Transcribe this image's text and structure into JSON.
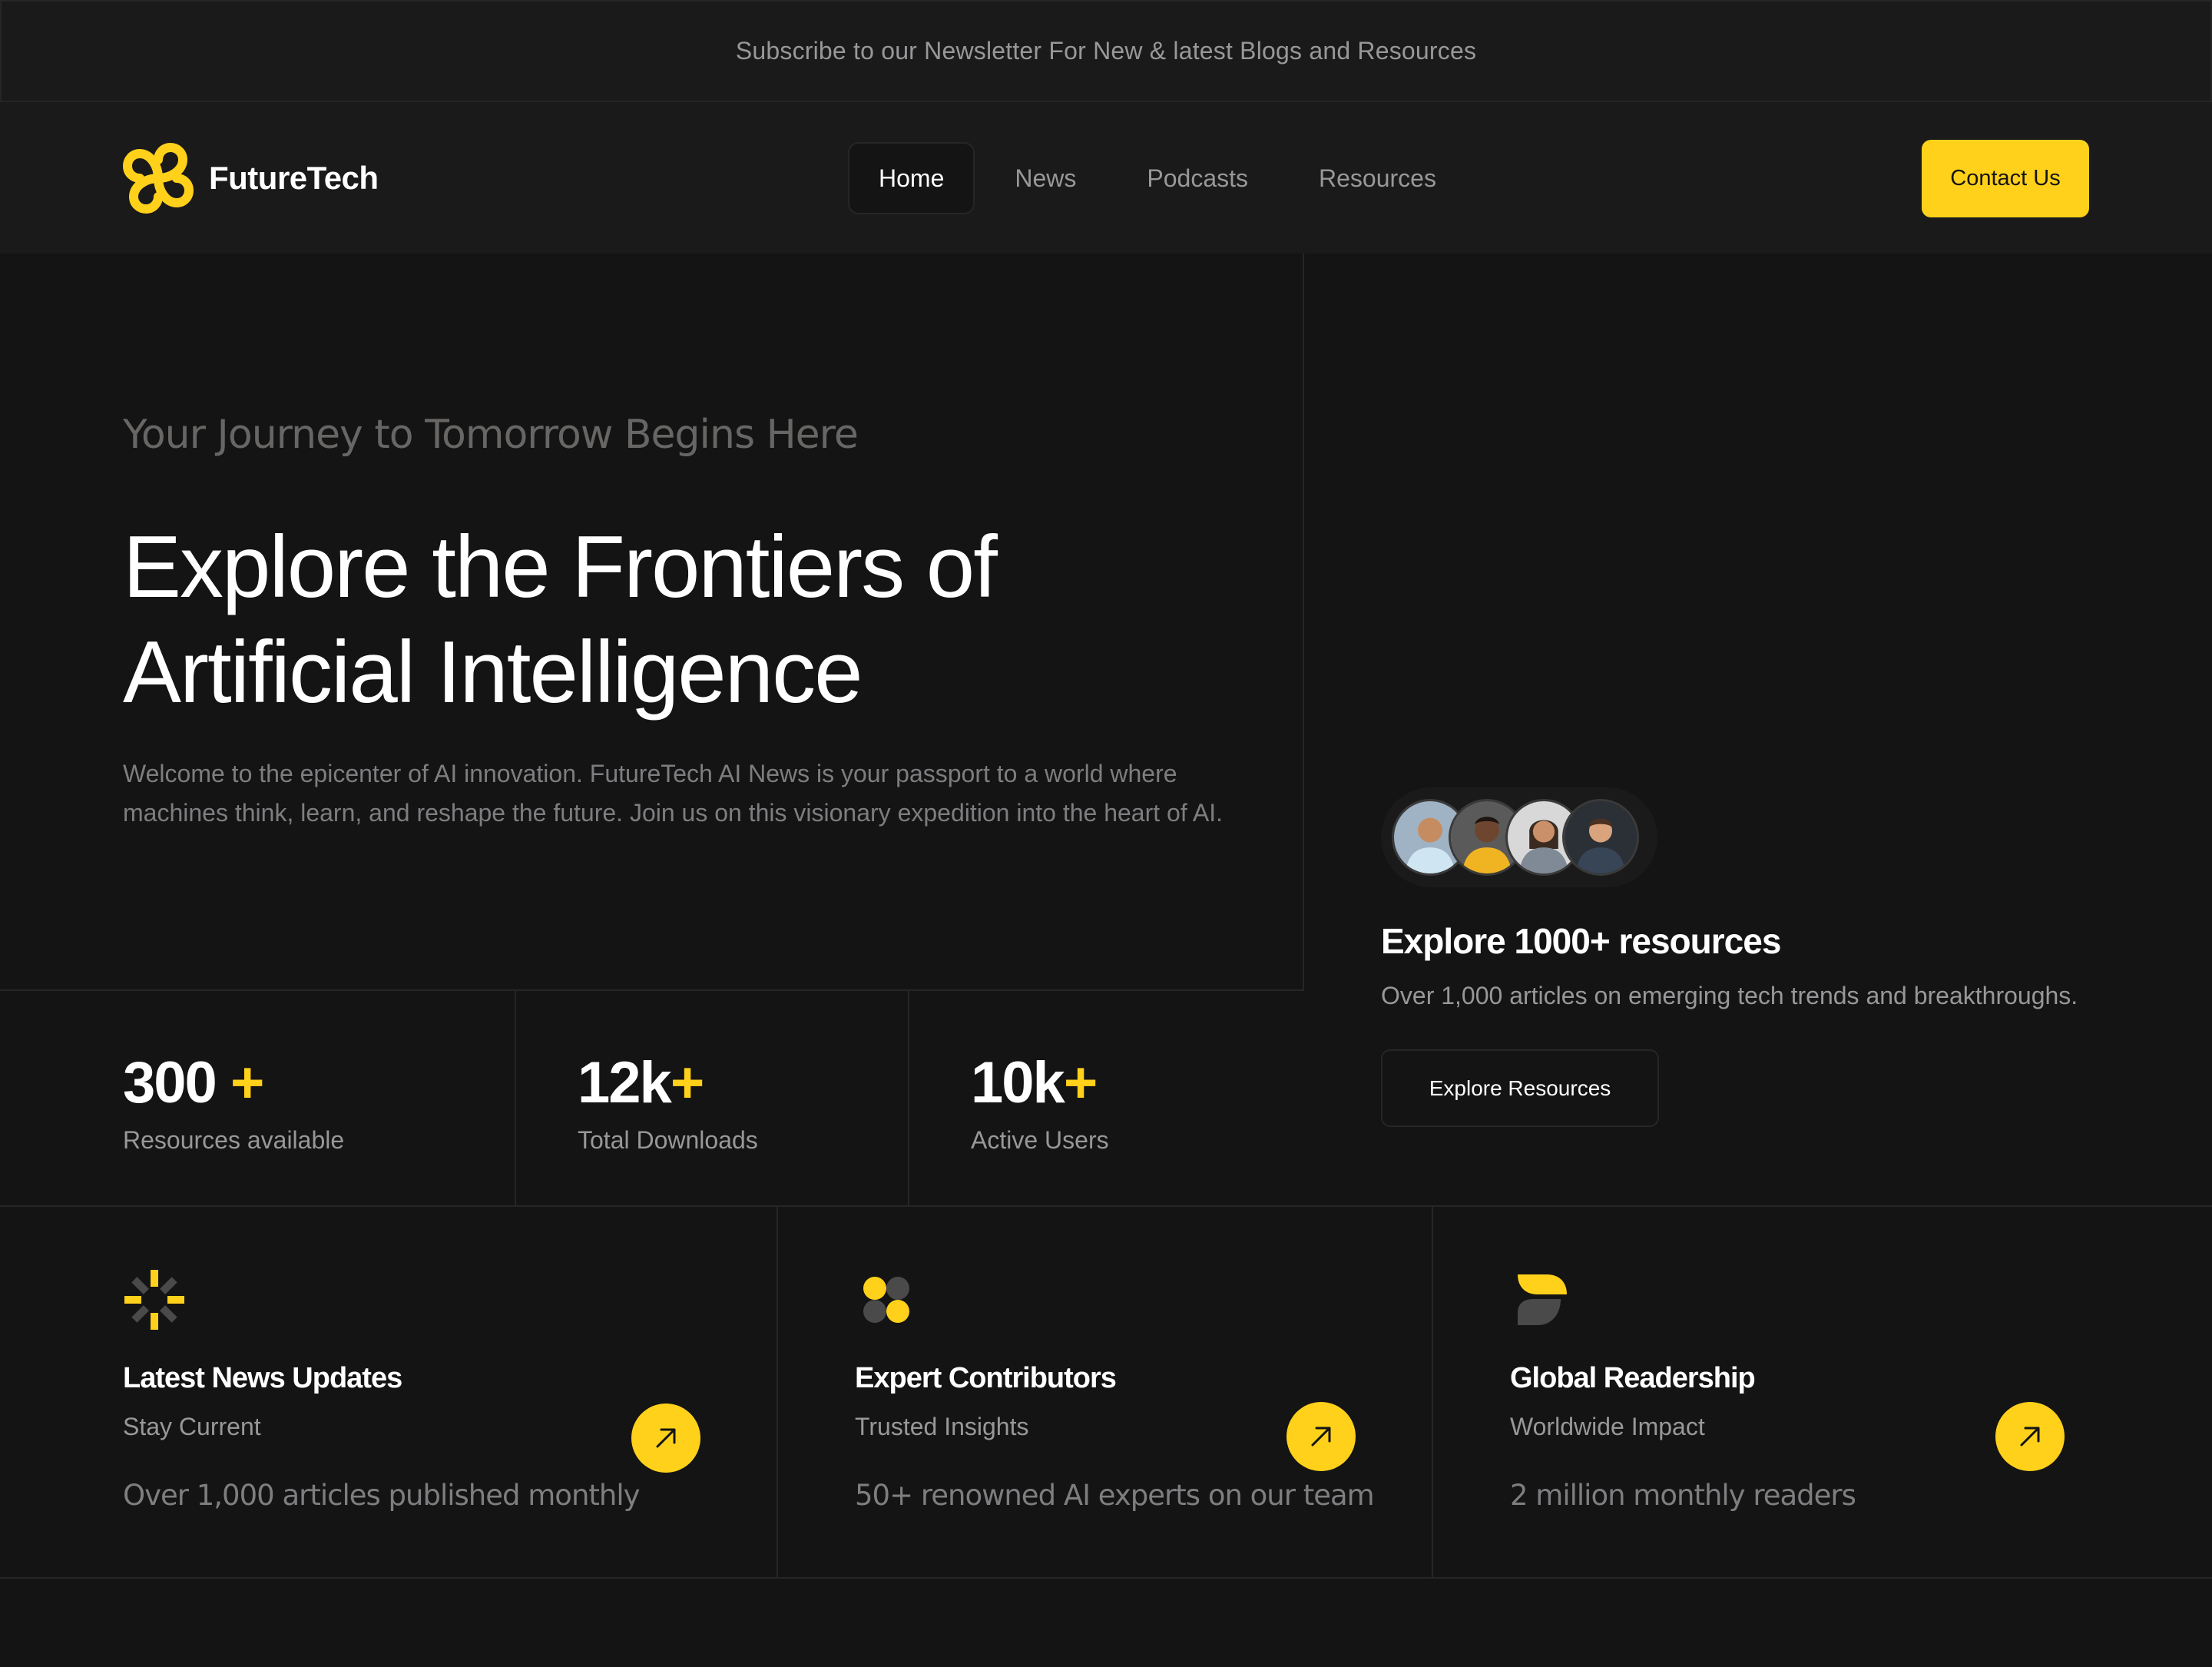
{
  "banner": {
    "text": "Subscribe to our Newsletter For New & latest Blogs and Resources"
  },
  "header": {
    "brand": "FutureTech",
    "nav": [
      {
        "label": "Home",
        "active": true
      },
      {
        "label": "News",
        "active": false
      },
      {
        "label": "Podcasts",
        "active": false
      },
      {
        "label": "Resources",
        "active": false
      }
    ],
    "contact_label": "Contact Us"
  },
  "hero": {
    "subtitle": "Your Journey to Tomorrow Begins Here",
    "title_line1": "Explore the Frontiers of",
    "title_line2": "Artificial Intelligence",
    "description": "Welcome to the epicenter of AI innovation. FutureTech AI News is your passport to a world where machines think, learn, and reshape the future. Join us on this visionary expedition into the heart of AI."
  },
  "stats": [
    {
      "value": "300",
      "plus": "+",
      "label": "Resources available"
    },
    {
      "value": "12k",
      "plus": "+",
      "label": "Total Downloads"
    },
    {
      "value": "10k",
      "plus": "+",
      "label": "Active Users"
    }
  ],
  "resources": {
    "title": "Explore 1000+ resources",
    "description": "Over 1,000 articles on emerging tech trends and breakthroughs.",
    "button_label": "Explore Resources"
  },
  "features": [
    {
      "icon": "sparkle-icon",
      "title": "Latest News Updates",
      "subtitle": "Stay Current",
      "description": "Over 1,000 articles published monthly"
    },
    {
      "icon": "circles-icon",
      "title": "Expert Contributors",
      "subtitle": "Trusted Insights",
      "description": "50+ renowned AI experts on our team"
    },
    {
      "icon": "leaf-icon",
      "title": "Global Readership",
      "subtitle": "Worldwide Impact",
      "description": "2 million monthly readers"
    }
  ],
  "colors": {
    "accent": "#ffd11a",
    "background": "#141414",
    "surface": "#1a1a1a",
    "border": "#262626",
    "muted_text": "#98989a"
  }
}
